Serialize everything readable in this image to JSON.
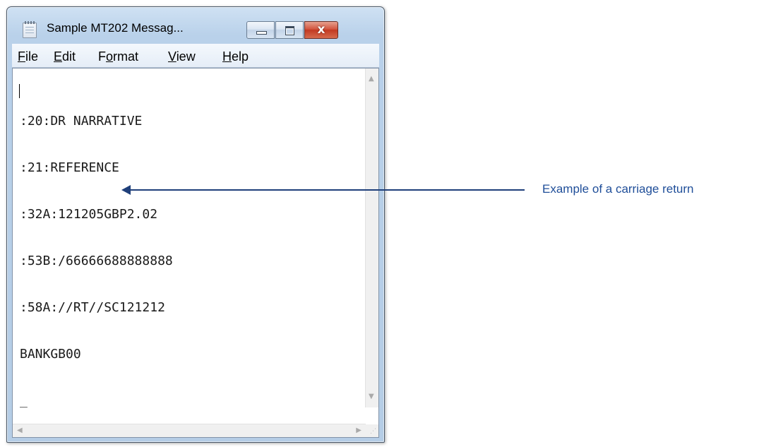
{
  "window": {
    "title": "Sample MT202 Messag...",
    "menu": [
      {
        "label": "File",
        "accel": "F",
        "rest": "ile"
      },
      {
        "label": "Edit",
        "accel": "E",
        "rest": "dit"
      },
      {
        "label": "Format",
        "pre": "F",
        "accel": "o",
        "rest": "rmat"
      },
      {
        "label": "View",
        "accel": "V",
        "rest": "iew"
      },
      {
        "label": "Help",
        "accel": "H",
        "rest": "elp"
      }
    ],
    "caption_buttons": {
      "close_glyph": "x"
    }
  },
  "document": {
    "lines": [
      ":20:DR NARRATIVE",
      ":21:REFERENCE",
      ":32A:121205GBP2.02",
      ":53B:/66666688888888",
      ":58A://RT//SC121212",
      "BANKGB00",
      "_"
    ]
  },
  "annotation": {
    "text": "Example of a carriage return",
    "color": "#1f4e99"
  },
  "icons": [
    "notepad-icon",
    "minimize-icon",
    "maximize-icon",
    "close-icon",
    "scroll-up-icon",
    "scroll-down-icon",
    "scroll-left-icon",
    "scroll-right-icon",
    "size-grip-icon",
    "arrow-icon"
  ]
}
